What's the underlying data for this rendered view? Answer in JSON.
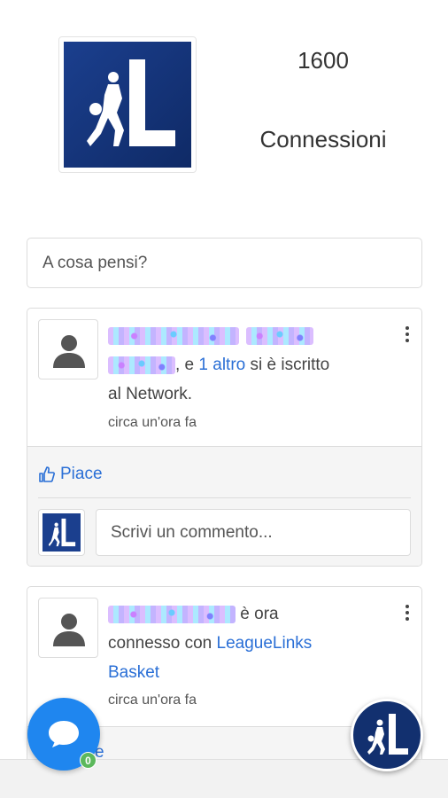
{
  "profile": {
    "connections_count": "1600",
    "connections_label": "Connessioni"
  },
  "composer": {
    "placeholder": "A cosa pensi?"
  },
  "feed": {
    "post1": {
      "text_join": ", e ",
      "others_link": "1 altro",
      "text_tail": " si è iscritto al Network.",
      "time": "circa un'ora fa",
      "like_label": "Piace",
      "comment_placeholder": "Scrivi un commento..."
    },
    "post2": {
      "text_mid": " è ora connesso con ",
      "link": "LeagueLinks Basket",
      "time": "circa un'ora fa",
      "like_label": "e"
    }
  },
  "chat": {
    "badge_count": "0"
  },
  "colors": {
    "accent": "#2a6fd6",
    "brand_blue": "#1b3f8e",
    "chat_blue": "#1f86ef",
    "badge_green": "#5cb85c"
  },
  "icons": [
    "league-logo",
    "user-silhouette-icon",
    "thumbs-up-icon",
    "more-vertical-icon",
    "chat-bubble-icon"
  ]
}
